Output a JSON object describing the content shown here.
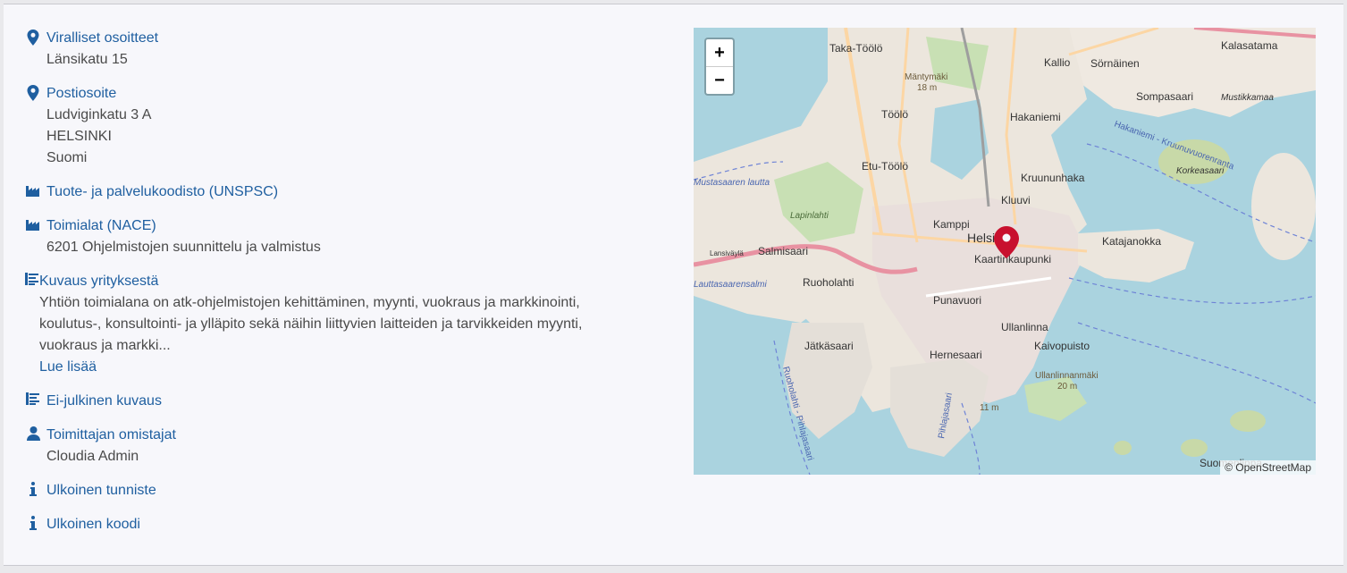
{
  "details": {
    "official_addresses": {
      "label": "Viralliset osoitteet",
      "lines": [
        "Länsikatu 15"
      ]
    },
    "postal_address": {
      "label": "Postiosoite",
      "lines": [
        "Ludviginkatu 3 A",
        "HELSINKI",
        "Suomi"
      ]
    },
    "unspsc": {
      "label": "Tuote- ja palvelukoodisto (UNSPSC)"
    },
    "nace": {
      "label": "Toimialat (NACE)",
      "lines": [
        "6201 Ohjelmistojen suunnittelu ja valmistus"
      ]
    },
    "description": {
      "label": "Kuvaus yrityksestä",
      "text": "Yhtiön toimialana on atk-ohjelmistojen kehittäminen, myynti, vuokraus ja markkinointi, koulutus-, konsultointi- ja ylläpito sekä näihin liittyvien laitteiden ja tarvikkeiden myynti, vuokraus ja markki...",
      "read_more": "Lue lisää"
    },
    "private_description": {
      "label": "Ei-julkinen kuvaus"
    },
    "supplier_owners": {
      "label": "Toimittajan omistajat",
      "lines": [
        "Cloudia Admin"
      ]
    },
    "external_id": {
      "label": "Ulkoinen tunniste"
    },
    "external_code": {
      "label": "Ulkoinen koodi"
    }
  },
  "map": {
    "zoom_in": "+",
    "zoom_out": "−",
    "attribution": "© OpenStreetMap",
    "marker_color": "#c8102e",
    "places": [
      "Taka-Töölö",
      "Kallio",
      "Sörnäinen",
      "Kalasatama",
      "Mäntymäki",
      "18 m",
      "Töölö",
      "Hakaniemi",
      "Sompasaari",
      "Mustikkamaa",
      "Etu-Töölö",
      "Kruununhaka",
      "Korkeasaari",
      "Mustasaaren lautta",
      "Kluuvi",
      "Lapinlahti",
      "Kamppi",
      "Helsinki",
      "Katajanokka",
      "Lansiväylä",
      "Salmisaari",
      "Kaartinkaupunki",
      "Lauttasaarensalmi",
      "Ruoholahti",
      "Punavuori",
      "Ullanlinna",
      "Jätkäsaari",
      "Kaivopuisto",
      "Hernesaari",
      "Ullanlinnanmäki",
      "20 m",
      "11 m",
      "Ruoholahti - Pihlajasaari",
      "Pihlajasaari",
      "Suomenlinna",
      "Hakaniemi - Kruunuvuorenranta"
    ]
  }
}
